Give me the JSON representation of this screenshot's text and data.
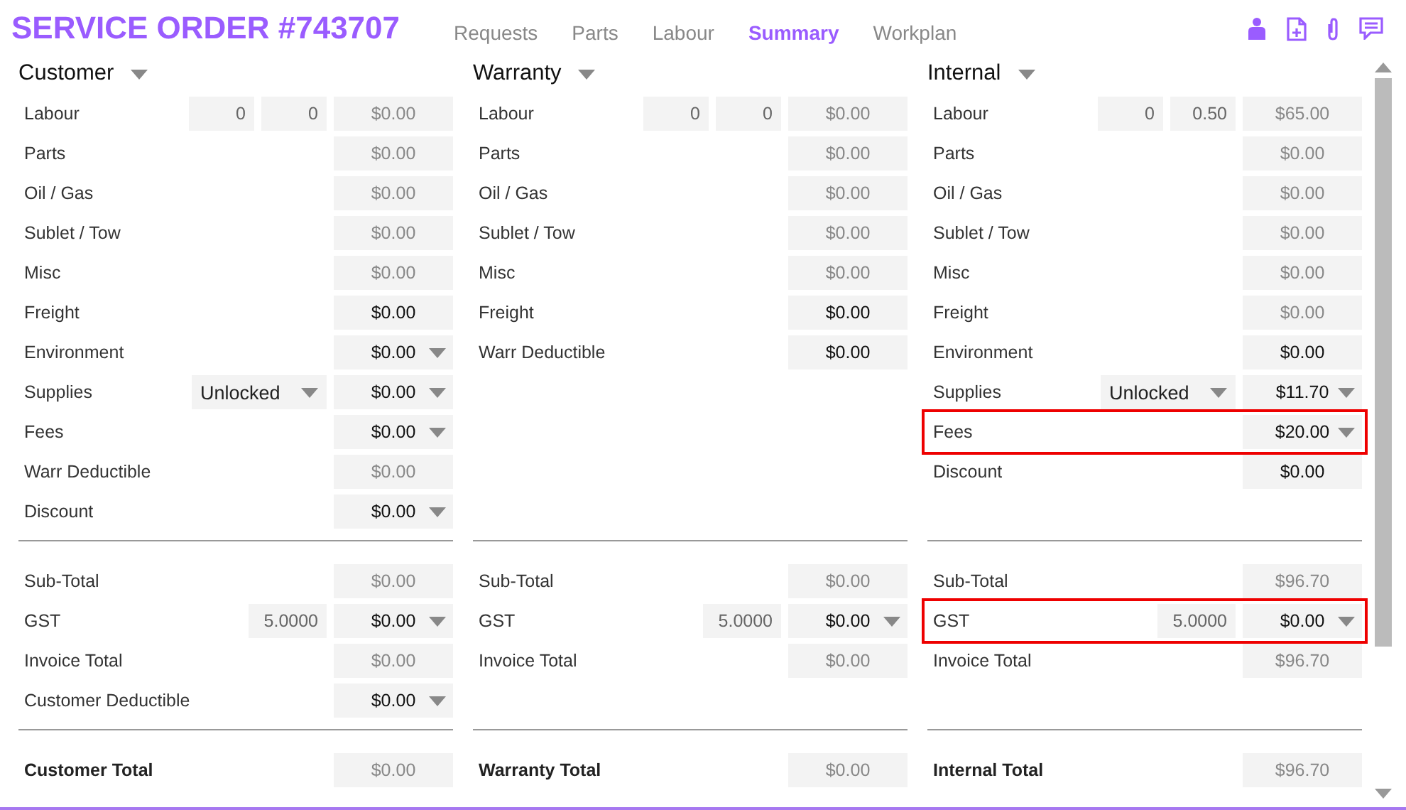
{
  "header": {
    "title": "SERVICE ORDER #743707",
    "tabs": [
      {
        "label": "Requests",
        "selected": false
      },
      {
        "label": "Parts",
        "selected": false
      },
      {
        "label": "Labour",
        "selected": false
      },
      {
        "label": "Summary",
        "selected": true
      },
      {
        "label": "Workplan",
        "selected": false
      }
    ]
  },
  "columns": [
    {
      "title": "Customer",
      "sections": [
        [
          {
            "label": "Labour",
            "extras": [
              {
                "kind": "number",
                "value": "0"
              },
              {
                "kind": "number",
                "value": "0"
              }
            ],
            "amount": "$0.00",
            "editable": false,
            "dropdown": false,
            "highlighted": false
          },
          {
            "label": "Parts",
            "amount": "$0.00",
            "editable": false,
            "dropdown": false,
            "highlighted": false
          },
          {
            "label": "Oil / Gas",
            "amount": "$0.00",
            "editable": false,
            "dropdown": false,
            "highlighted": false
          },
          {
            "label": "Sublet / Tow",
            "amount": "$0.00",
            "editable": false,
            "dropdown": false,
            "highlighted": false
          },
          {
            "label": "Misc",
            "amount": "$0.00",
            "editable": false,
            "dropdown": false,
            "highlighted": false
          },
          {
            "label": "Freight",
            "amount": "$0.00",
            "editable": true,
            "dropdown": false,
            "highlighted": false
          },
          {
            "label": "Environment",
            "amount": "$0.00",
            "editable": true,
            "dropdown": true,
            "highlighted": false
          },
          {
            "label": "Supplies",
            "extras": [
              {
                "kind": "select",
                "value": "Unlocked"
              }
            ],
            "amount": "$0.00",
            "editable": true,
            "dropdown": true,
            "highlighted": false
          },
          {
            "label": "Fees",
            "amount": "$0.00",
            "editable": true,
            "dropdown": true,
            "highlighted": false
          },
          {
            "label": "Warr Deductible",
            "amount": "$0.00",
            "editable": false,
            "dropdown": false,
            "highlighted": false
          },
          {
            "label": "Discount",
            "amount": "$0.00",
            "editable": true,
            "dropdown": true,
            "highlighted": false
          }
        ],
        [
          {
            "label": "Sub-Total",
            "amount": "$0.00",
            "editable": false,
            "dropdown": false,
            "highlighted": false
          },
          {
            "label": "GST",
            "extras": [
              {
                "kind": "rate",
                "value": "5.0000"
              }
            ],
            "amount": "$0.00",
            "editable": true,
            "dropdown": true,
            "highlighted": false
          },
          {
            "label": "Invoice Total",
            "amount": "$0.00",
            "editable": false,
            "dropdown": false,
            "highlighted": false
          },
          {
            "label": "Customer Deductible",
            "amount": "$0.00",
            "editable": true,
            "dropdown": true,
            "highlighted": false
          }
        ],
        [
          {
            "label": "Customer Total",
            "amount": "$0.00",
            "editable": false,
            "dropdown": false,
            "highlighted": false
          }
        ]
      ]
    },
    {
      "title": "Warranty",
      "sections": [
        [
          {
            "label": "Labour",
            "extras": [
              {
                "kind": "number",
                "value": "0"
              },
              {
                "kind": "number",
                "value": "0"
              }
            ],
            "amount": "$0.00",
            "editable": false,
            "dropdown": false,
            "highlighted": false
          },
          {
            "label": "Parts",
            "amount": "$0.00",
            "editable": false,
            "dropdown": false,
            "highlighted": false
          },
          {
            "label": "Oil / Gas",
            "amount": "$0.00",
            "editable": false,
            "dropdown": false,
            "highlighted": false
          },
          {
            "label": "Sublet / Tow",
            "amount": "$0.00",
            "editable": false,
            "dropdown": false,
            "highlighted": false
          },
          {
            "label": "Misc",
            "amount": "$0.00",
            "editable": false,
            "dropdown": false,
            "highlighted": false
          },
          {
            "label": "Freight",
            "amount": "$0.00",
            "editable": true,
            "dropdown": false,
            "highlighted": false
          },
          {
            "label": "Warr Deductible",
            "amount": "$0.00",
            "editable": true,
            "dropdown": false,
            "highlighted": false
          }
        ],
        [
          {
            "label": "Sub-Total",
            "amount": "$0.00",
            "editable": false,
            "dropdown": false,
            "highlighted": false
          },
          {
            "label": "GST",
            "extras": [
              {
                "kind": "rate",
                "value": "5.0000"
              }
            ],
            "amount": "$0.00",
            "editable": true,
            "dropdown": true,
            "highlighted": false
          },
          {
            "label": "Invoice Total",
            "amount": "$0.00",
            "editable": false,
            "dropdown": false,
            "highlighted": false
          }
        ],
        [
          {
            "label": "Warranty Total",
            "amount": "$0.00",
            "editable": false,
            "dropdown": false,
            "highlighted": false
          }
        ]
      ]
    },
    {
      "title": "Internal",
      "sections": [
        [
          {
            "label": "Labour",
            "extras": [
              {
                "kind": "number",
                "value": "0"
              },
              {
                "kind": "number",
                "value": "0.50"
              }
            ],
            "amount": "$65.00",
            "editable": false,
            "dropdown": false,
            "highlighted": false
          },
          {
            "label": "Parts",
            "amount": "$0.00",
            "editable": false,
            "dropdown": false,
            "highlighted": false
          },
          {
            "label": "Oil / Gas",
            "amount": "$0.00",
            "editable": false,
            "dropdown": false,
            "highlighted": false
          },
          {
            "label": "Sublet / Tow",
            "amount": "$0.00",
            "editable": false,
            "dropdown": false,
            "highlighted": false
          },
          {
            "label": "Misc",
            "amount": "$0.00",
            "editable": false,
            "dropdown": false,
            "highlighted": false
          },
          {
            "label": "Freight",
            "amount": "$0.00",
            "editable": false,
            "dropdown": false,
            "highlighted": false
          },
          {
            "label": "Environment",
            "amount": "$0.00",
            "editable": true,
            "dropdown": false,
            "highlighted": false
          },
          {
            "label": "Supplies",
            "extras": [
              {
                "kind": "select",
                "value": "Unlocked"
              }
            ],
            "amount": "$11.70",
            "editable": true,
            "dropdown": true,
            "highlighted": false
          },
          {
            "label": "Fees",
            "amount": "$20.00",
            "editable": true,
            "dropdown": true,
            "highlighted": true
          },
          {
            "label": "Discount",
            "amount": "$0.00",
            "editable": true,
            "dropdown": false,
            "highlighted": false
          }
        ],
        [
          {
            "label": "Sub-Total",
            "amount": "$96.70",
            "editable": false,
            "dropdown": false,
            "highlighted": false
          },
          {
            "label": "GST",
            "extras": [
              {
                "kind": "rate",
                "value": "5.0000"
              }
            ],
            "amount": "$0.00",
            "editable": true,
            "dropdown": true,
            "highlighted": true
          },
          {
            "label": "Invoice Total",
            "amount": "$96.70",
            "editable": false,
            "dropdown": false,
            "highlighted": false
          }
        ],
        [
          {
            "label": "Internal Total",
            "amount": "$96.70",
            "editable": false,
            "dropdown": false,
            "highlighted": false
          }
        ]
      ]
    }
  ]
}
